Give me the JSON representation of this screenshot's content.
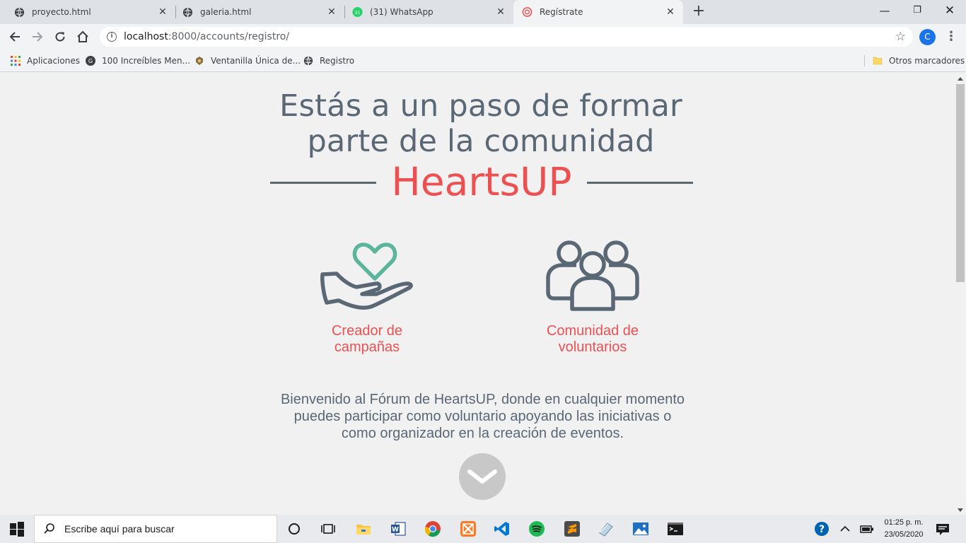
{
  "browser": {
    "tabs": [
      {
        "title": "proyecto.html",
        "icon": "globe-icon"
      },
      {
        "title": "galeria.html",
        "icon": "globe-icon"
      },
      {
        "title": "(31) WhatsApp",
        "icon": "whatsapp-icon",
        "badge": "31"
      },
      {
        "title": "Regístrate",
        "icon": "heartsup-favicon",
        "active": true
      }
    ],
    "url_host": "localhost",
    "url_path": ":8000/accounts/registro/",
    "profile_initial": "C",
    "bookmarks": [
      {
        "label": "Aplicaciones",
        "icon": "apps-grid-icon"
      },
      {
        "label": "100 Increíbles Men...",
        "icon": "site-icon"
      },
      {
        "label": "Ventanilla Única de...",
        "icon": "emblem-icon"
      },
      {
        "label": "Registro",
        "icon": "globe-icon"
      }
    ],
    "other_bookmarks": "Otros marcadores"
  },
  "page": {
    "headline_line1": "Estás a un paso de formar",
    "headline_line2": "parte de la comunidad",
    "brand": "HeartsUP",
    "cards": [
      {
        "line1": "Creador de",
        "line2": "campañas",
        "icon": "heart-hand-icon"
      },
      {
        "line1": "Comunidad de",
        "line2": "voluntarios",
        "icon": "people-group-icon"
      }
    ],
    "welcome_line1": "Bienvenido al Fórum de HeartsUP, donde en cualquier momento",
    "welcome_line2": "puedes participar como voluntario apoyando las iniciativas o",
    "welcome_line3": "como organizador en la creación de eventos.",
    "colors": {
      "accent": "#ed5051",
      "text": "#5a6775",
      "heart": "#5bb59b"
    }
  },
  "taskbar": {
    "search_placeholder": "Escribe aquí para buscar",
    "time": "01:25 p. m.",
    "date": "23/05/2020"
  }
}
